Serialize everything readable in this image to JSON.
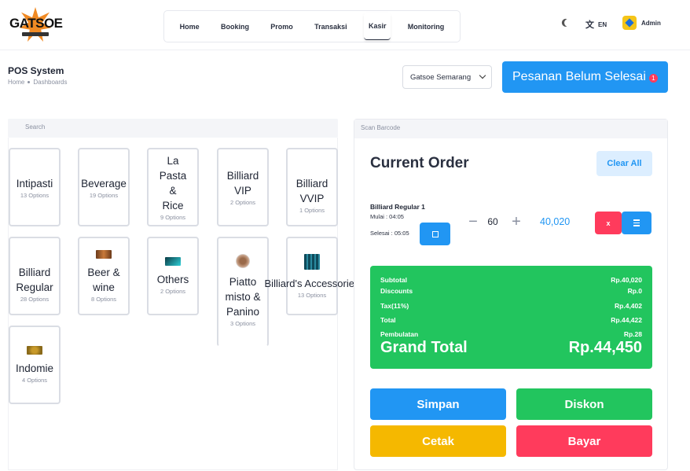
{
  "brand": {
    "name": "GATSOE"
  },
  "nav": {
    "items": [
      "Home",
      "Booking",
      "Promo",
      "Transaksi",
      "Kasir",
      "Monitoring"
    ],
    "active": "Kasir"
  },
  "header": {
    "lang": "EN",
    "user": "Admin"
  },
  "page": {
    "title": "POS System",
    "breadcrumb": [
      "Home",
      "Dashboards"
    ]
  },
  "branch": {
    "selected": "Gatsoe Semarang"
  },
  "pending": {
    "label": "Pesanan Belum Selesai",
    "count": "1"
  },
  "search": {
    "placeholder": "Search"
  },
  "categories": [
    {
      "name": "Intipasti",
      "options": "13 Options"
    },
    {
      "name": "Beverage",
      "options": "19 Options"
    },
    {
      "name": "La Pasta & Rice",
      "options": "9 Options"
    },
    {
      "name": "Billiard VIP",
      "options": "2 Options"
    },
    {
      "name": "Billiard VVIP",
      "options": "1 Options"
    },
    {
      "name": "Billiard Regular",
      "options": "28 Options"
    },
    {
      "name": "Beer & wine",
      "options": "8 Options"
    },
    {
      "name": "Others",
      "options": "2 Options"
    },
    {
      "name": "Piatto misto & Panino",
      "options": "3 Options"
    },
    {
      "name": "Billiard's Accessories",
      "options": "13 Options"
    },
    {
      "name": "Indomie",
      "options": "4 Options"
    }
  ],
  "order": {
    "scan_placeholder": "Scan Barcode",
    "title": "Current Order",
    "clear_label": "Clear All",
    "item": {
      "name": "Billiard Regular 1",
      "start": "Mulai : 04:05",
      "end": "Selesai : 05:05",
      "minus": "−",
      "qty": "60",
      "plus": "+",
      "price": "40,020",
      "remove_label": "x"
    },
    "summary": [
      {
        "label": "Subtotal",
        "value": "Rp.40,020"
      },
      {
        "label": "Discounts",
        "value": "Rp.0"
      },
      {
        "label": "Tax(11%)",
        "value": "Rp.4,402"
      },
      {
        "label": "Total",
        "value": "Rp.44,422"
      },
      {
        "label": "Pembulatan",
        "value": "Rp.28"
      }
    ],
    "grand_total": {
      "label": "Grand Total",
      "value": "Rp.44,450"
    }
  },
  "actions": {
    "save": "Simpan",
    "discount": "Diskon",
    "print": "Cetak",
    "pay": "Bayar"
  },
  "colors": {
    "primary": "#2196f3",
    "success": "#22c55e",
    "warning": "#f5b800",
    "danger": "#ff3b5c",
    "totals_bg": "#22c55e"
  }
}
